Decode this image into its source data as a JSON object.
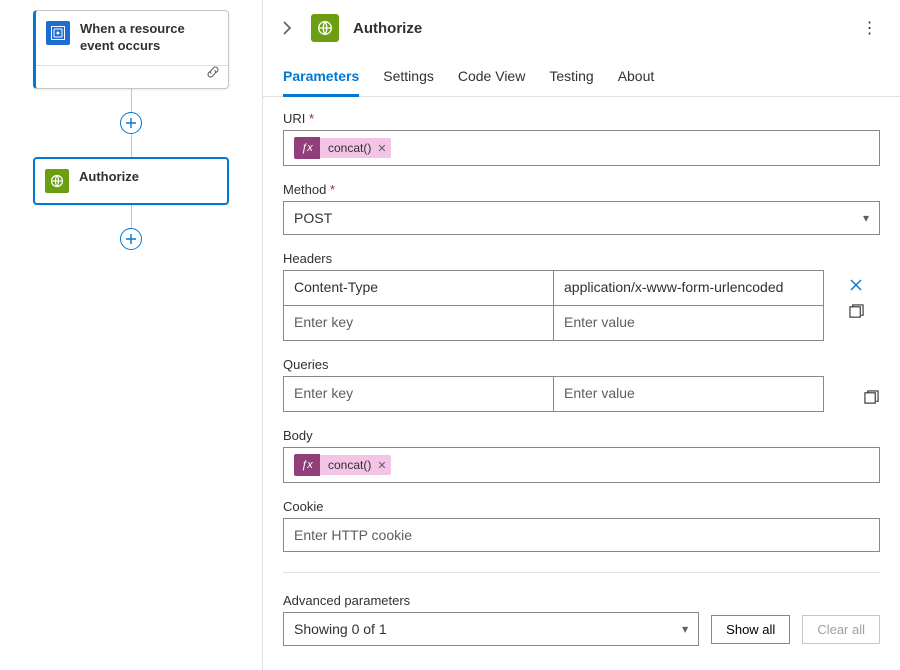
{
  "canvas": {
    "trigger": {
      "title": "When a resource event occurs"
    },
    "action": {
      "title": "Authorize"
    }
  },
  "panel": {
    "title": "Authorize"
  },
  "tabs": [
    {
      "label": "Parameters",
      "active": true
    },
    {
      "label": "Settings",
      "active": false
    },
    {
      "label": "Code View",
      "active": false
    },
    {
      "label": "Testing",
      "active": false
    },
    {
      "label": "About",
      "active": false
    }
  ],
  "form": {
    "uri": {
      "label": "URI",
      "token": "concat()"
    },
    "method": {
      "label": "Method",
      "value": "POST"
    },
    "headers": {
      "label": "Headers",
      "rows": [
        {
          "key": "Content-Type",
          "value": "application/x-www-form-urlencoded"
        }
      ],
      "key_placeholder": "Enter key",
      "value_placeholder": "Enter value"
    },
    "queries": {
      "label": "Queries",
      "key_placeholder": "Enter key",
      "value_placeholder": "Enter value"
    },
    "body": {
      "label": "Body",
      "token": "concat()"
    },
    "cookie": {
      "label": "Cookie",
      "placeholder": "Enter HTTP cookie"
    },
    "advanced": {
      "label": "Advanced parameters",
      "summary": "Showing 0 of 1",
      "show_all": "Show all",
      "clear_all": "Clear all"
    }
  }
}
